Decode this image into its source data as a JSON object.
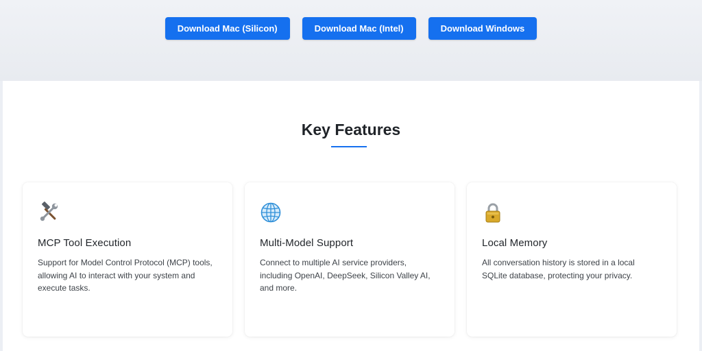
{
  "downloads": {
    "mac_silicon": "Download Mac (Silicon)",
    "mac_intel": "Download Mac (Intel)",
    "windows": "Download Windows"
  },
  "features": {
    "title": "Key Features",
    "items": [
      {
        "icon": "tools-icon",
        "title": "MCP Tool Execution",
        "description": "Support for Model Control Protocol (MCP) tools, allowing AI to interact with your system and execute tasks."
      },
      {
        "icon": "globe-icon",
        "title": "Multi-Model Support",
        "description": "Connect to multiple AI service providers, including OpenAI, DeepSeek, Silicon Valley AI, and more."
      },
      {
        "icon": "lock-icon",
        "title": "Local Memory",
        "description": "All conversation history is stored in a local SQLite database, protecting your privacy."
      }
    ]
  },
  "colors": {
    "accent": "#1570ef",
    "hero_bg": "#eceff4",
    "card_bg": "#ffffff"
  }
}
